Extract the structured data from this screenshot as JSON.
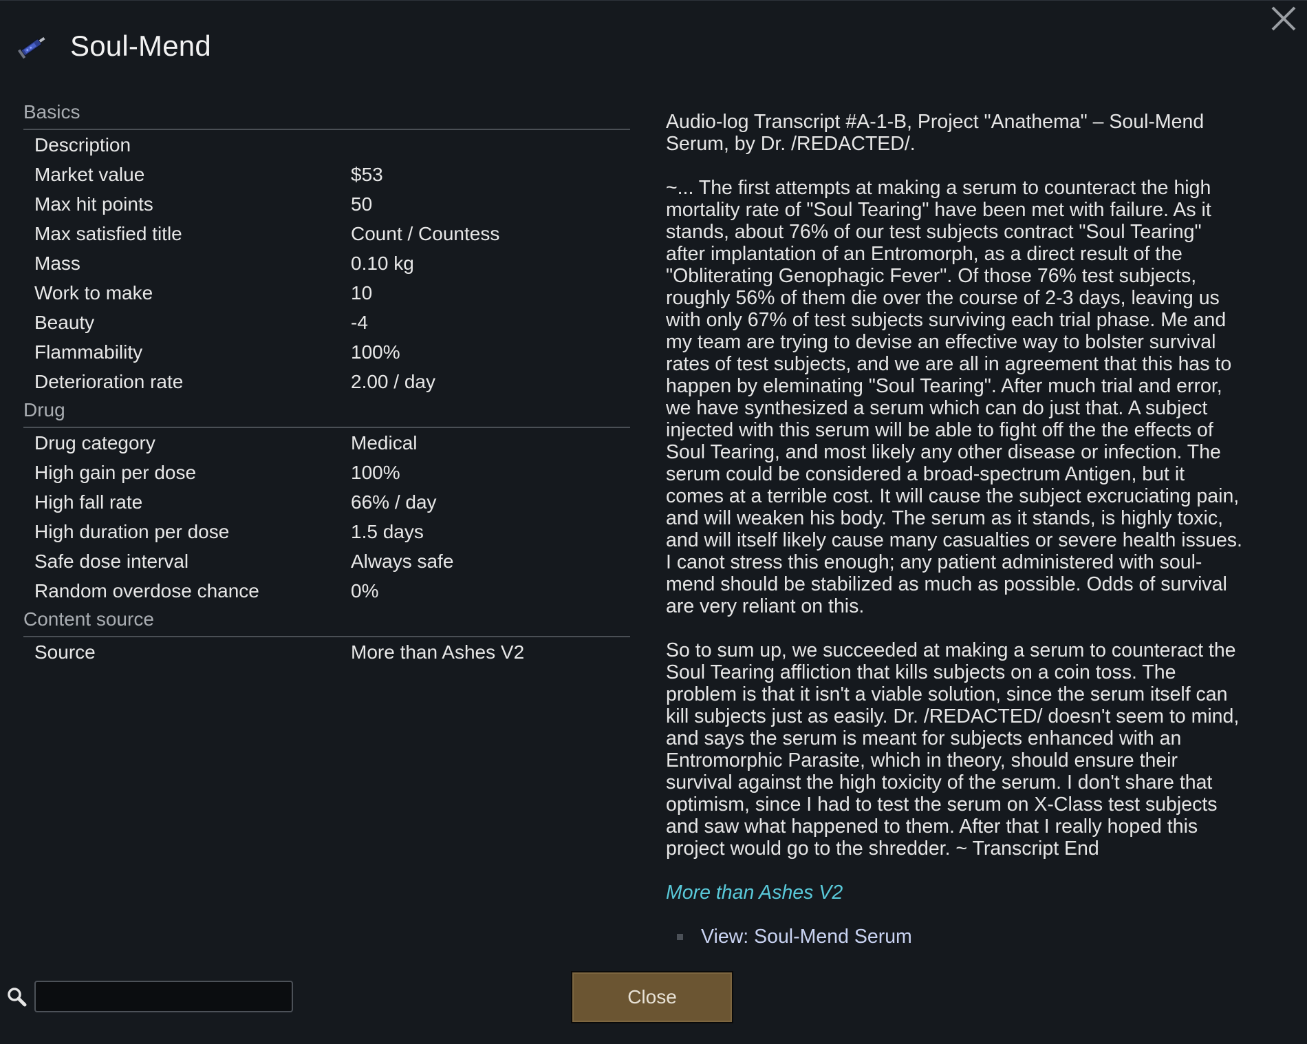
{
  "window": {
    "title": "Soul-Mend"
  },
  "sections": [
    {
      "heading": "Basics",
      "rows": [
        {
          "label": "Description",
          "value": ""
        },
        {
          "label": "Market value",
          "value": "$53"
        },
        {
          "label": "Max hit points",
          "value": "50"
        },
        {
          "label": "Max satisfied title",
          "value": "Count / Countess"
        },
        {
          "label": "Mass",
          "value": "0.10 kg"
        },
        {
          "label": "Work to make",
          "value": "10"
        },
        {
          "label": "Beauty",
          "value": "-4"
        },
        {
          "label": "Flammability",
          "value": "100%"
        },
        {
          "label": "Deterioration rate",
          "value": "2.00 / day"
        }
      ]
    },
    {
      "heading": "Drug",
      "rows": [
        {
          "label": "Drug category",
          "value": "Medical"
        },
        {
          "label": "High gain per dose",
          "value": "100%"
        },
        {
          "label": "High fall rate",
          "value": "66% / day"
        },
        {
          "label": "High duration per dose",
          "value": "1.5 days"
        },
        {
          "label": "Safe dose interval",
          "value": "Always safe"
        },
        {
          "label": "Random overdose chance",
          "value": "0%"
        }
      ]
    },
    {
      "heading": "Content source",
      "rows": [
        {
          "label": "Source",
          "value": "More than Ashes V2"
        }
      ]
    }
  ],
  "description": {
    "paragraphs": [
      "Audio-log Transcript #A-1-B, Project \"Anathema\" – Soul-Mend Serum, by Dr. /REDACTED/.",
      "~... The first attempts at making a serum to counteract the high mortality rate of \"Soul Tearing\" have been met with failure. As it stands, about 76% of our test subjects contract \"Soul Tearing\" after implantation of an Entromorph, as a direct result of the \"Obliterating Genophagic Fever\". Of those 76% test subjects, roughly 56% of them die over the course of 2-3 days, leaving us with only 67% of test subjects surviving each trial phase. Me and my team are trying to devise an effective way to bolster survival rates of test subjects, and we are all in agreement that this has to happen by eleminating \"Soul Tearing\". After much trial and error, we have synthesized a serum which can do just that. A subject injected with this serum will be able to fight off the the effects of Soul Tearing, and most likely any other disease or infection. The serum could be considered a broad-spectrum Antigen, but it comes at a terrible cost. It will cause the subject excruciating pain, and will weaken his body. The serum as it stands, is highly toxic, and will itself likely cause many casualties or severe health issues. I canot stress this enough; any patient administered with soul-mend should be stabilized as much as possible. Odds of survival are very reliant on this.",
      "So to sum up, we succeeded at making a serum to counteract the Soul Tearing affliction that kills subjects on a coin toss. The problem is that it isn't a viable solution, since the serum itself can kill subjects just as easily. Dr. /REDACTED/ doesn't seem to mind, and says the serum is meant for subjects enhanced with an Entromorphic Parasite, which in theory, should ensure their survival against the high toxicity of the serum. I don't share that optimism, since I had to test the serum on X-Class test subjects and saw what happened to them. After that I really hoped this project would go to the shredder. ~ Transcript End"
    ],
    "mod_name": "More than Ashes V2",
    "hyperlink": "View: Soul-Mend Serum"
  },
  "search": {
    "value": "",
    "placeholder": ""
  },
  "buttons": {
    "close_label": "Close"
  },
  "icons": {
    "thing_icon": "syringe-icon",
    "search_icon": "magnifier-icon",
    "close_icon": "x-icon"
  },
  "colors": {
    "background": "#15191e",
    "section_heading": "#a9adb2",
    "mod_link": "#59c9d9",
    "hyperlink": "#c9d3f2",
    "button": "#6b5532"
  }
}
